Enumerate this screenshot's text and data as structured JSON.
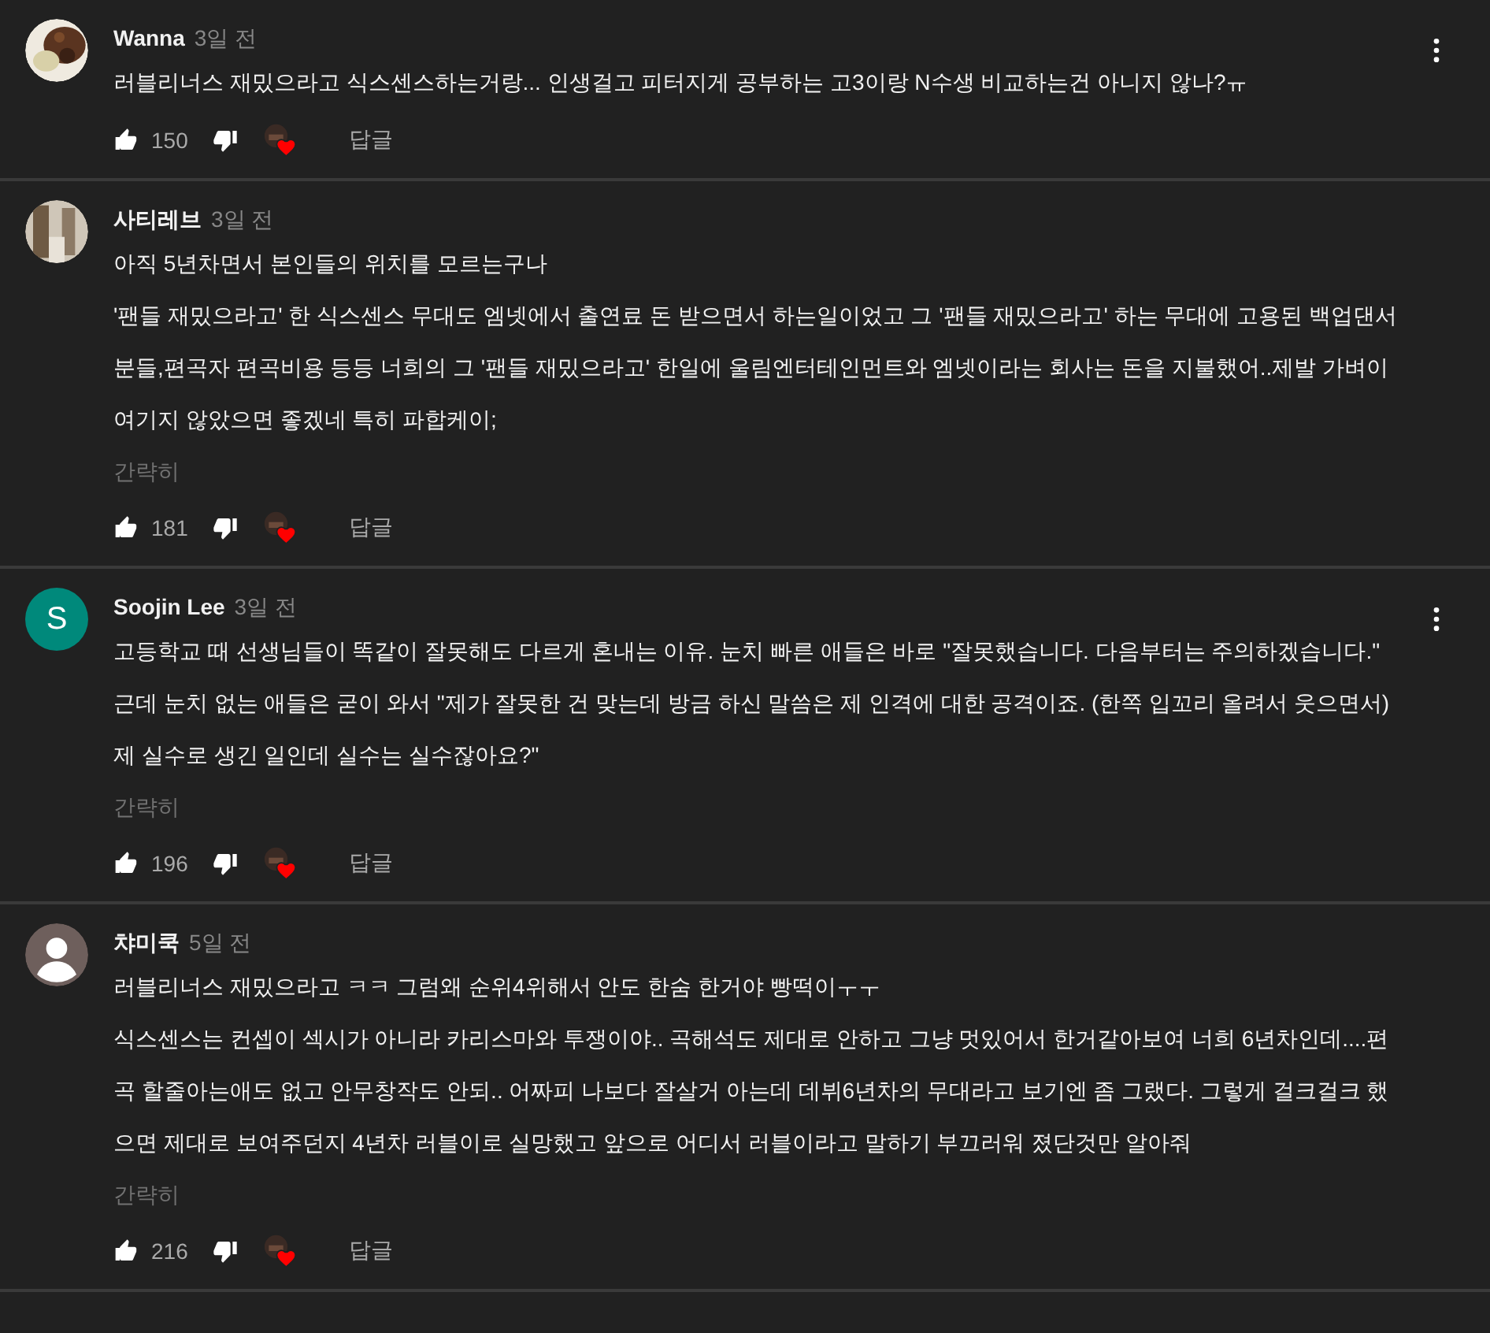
{
  "comments": [
    {
      "avatar": {
        "kind": "picture"
      },
      "author": "Wanna",
      "time": "3일 전",
      "paragraphs": [
        "러블리너스 재밌으라고 식스센스하는거랑... 인생걸고 피터지게 공부하는 고3이랑 N수생 비교하는건 아니지 않나?ㅠ"
      ],
      "likes": "150",
      "hearted": true,
      "reply": "답글",
      "menu": true
    },
    {
      "avatar": {
        "kind": "picture"
      },
      "author": "사티레브",
      "time": "3일 전",
      "paragraphs": [
        "아직 5년차면서 본인들의 위치를 모르는구나",
        "'팬들 재밌으라고' 한 식스센스 무대도 엠넷에서 출연료 돈 받으면서 하는일이었고 그 '팬들 재밌으라고' 하는 무대에 고용된 백업댄서 분들,편곡자 편곡비용 등등 너희의 그 '팬들 재밌으라고' 한일에 울림엔터테인먼트와 엠넷이라는 회사는 돈을 지불했어..제발 가벼이 여기지 않았으면 좋겠네 특히 파합케이;"
      ],
      "collapse": "간략히",
      "likes": "181",
      "hearted": true,
      "reply": "답글",
      "menu": false
    },
    {
      "avatar": {
        "kind": "letter",
        "letter": "S",
        "color": "#00897b"
      },
      "author": "Soojin Lee",
      "time": "3일 전",
      "paragraphs": [
        "고등학교 때 선생님들이 똑같이 잘못해도 다르게 혼내는 이유. 눈치 빠른 애들은 바로 \"잘못했습니다. 다음부터는 주의하겠습니다.\" 근데 눈치 없는 애들은 굳이 와서 \"제가 잘못한 건 맞는데 방금 하신 말씀은 제 인격에 대한 공격이죠. (한쪽 입꼬리 올려서 웃으면서) 제 실수로 생긴 일인데 실수는 실수잖아요?\""
      ],
      "collapse": "간략히",
      "likes": "196",
      "hearted": true,
      "reply": "답글",
      "menu": true
    },
    {
      "avatar": {
        "kind": "silhouette"
      },
      "author": "챠미쿡",
      "time": "5일 전",
      "paragraphs": [
        "러블리너스 재밌으라고 ㅋㅋ 그럼왜 순위4위해서 안도 한숨 한거야 빵떡이ㅜㅜ",
        "식스센스는 컨셉이 섹시가 아니라 카리스마와 투쟁이야.. 곡해석도 제대로 안하고 그냥 멋있어서 한거같아보여 너희 6년차인데....편곡 할줄아는애도 없고 안무창작도 안되.. 어짜피 나보다 잘살거 아는데 데뷔6년차의 무대라고 보기엔 좀 그랬다. 그렇게 걸크걸크 했으면 제대로 보여주던지 4년차 러블이로 실망했고 앞으로 어디서 러블이라고 말하기 부끄러워 졌단것만 알아줘"
      ],
      "collapse": "간략히",
      "likes": "216",
      "hearted": true,
      "reply": "답글",
      "menu": false
    }
  ]
}
